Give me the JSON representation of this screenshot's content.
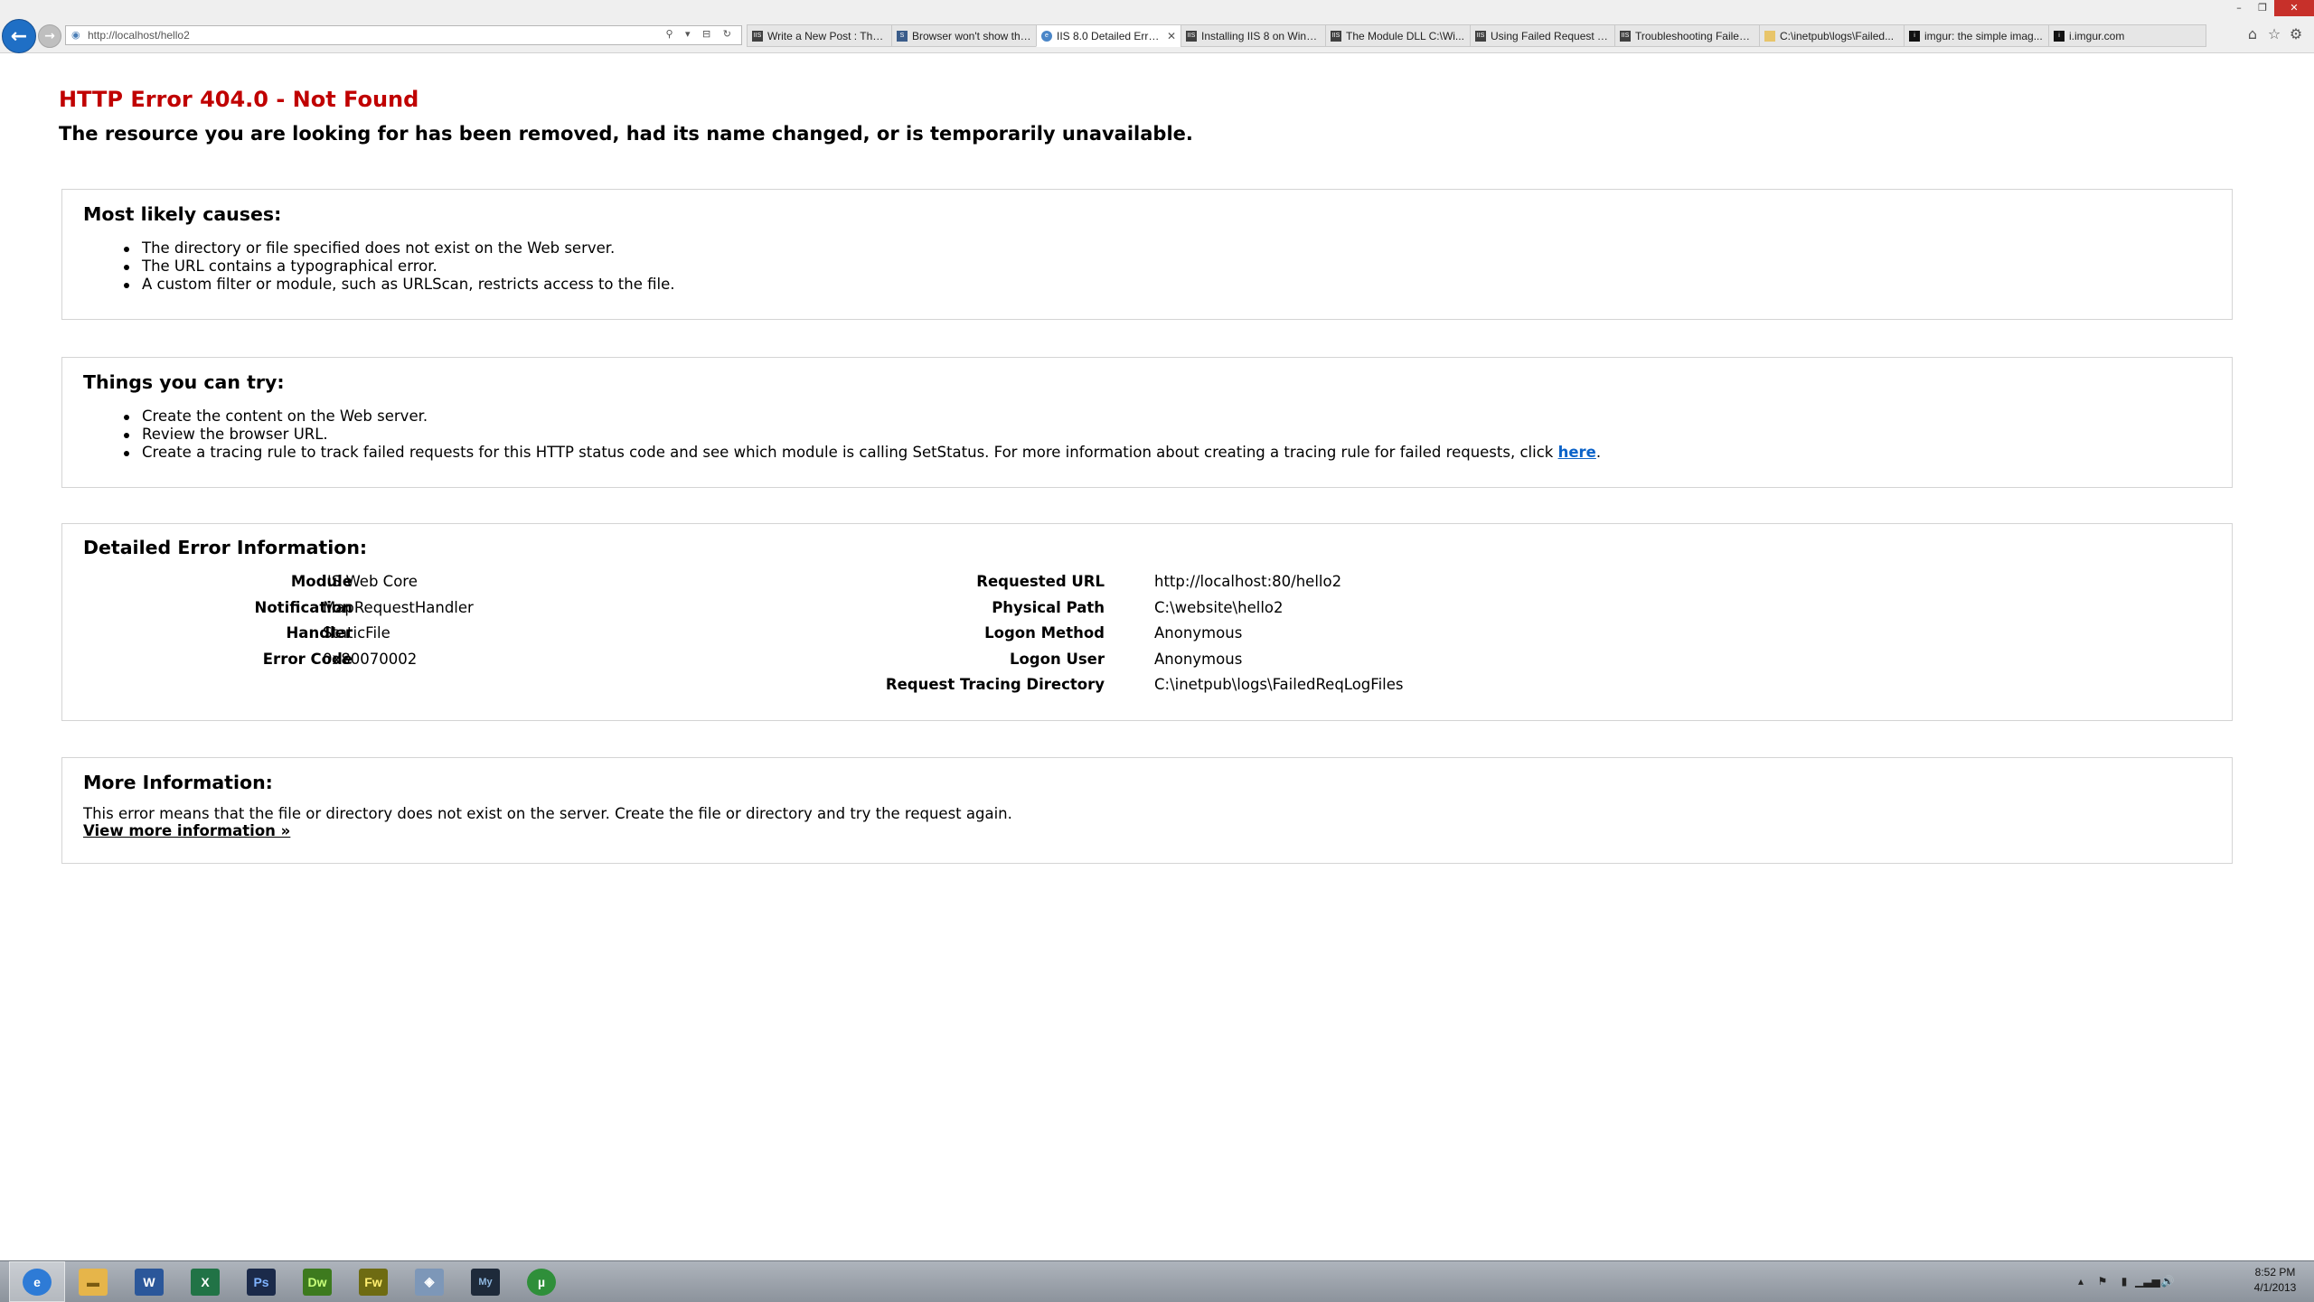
{
  "browser": {
    "window_controls": {
      "minimize": "–",
      "restore": "❐",
      "close": "✕"
    },
    "back_icon": "←",
    "forward_icon": "→",
    "address_url": "http://localhost/hello2",
    "address_tools": "⚲ ▾ ⊟ ↻",
    "tabs": [
      {
        "title": "Write a New Post : The ...",
        "icon": "iis"
      },
      {
        "title": "Browser won't show the...",
        "icon": "ms"
      },
      {
        "title": "IIS 8.0 Detailed Error ...",
        "icon": "ie",
        "active": true,
        "close": "✕"
      },
      {
        "title": "Installing IIS 8 on Wind...",
        "icon": "iis"
      },
      {
        "title": "The Module DLL C:\\Wi...",
        "icon": "iis"
      },
      {
        "title": "Using Failed Request Tr...",
        "icon": "iis"
      },
      {
        "title": "Troubleshooting Failed ...",
        "icon": "iis"
      },
      {
        "title": "C:\\inetpub\\logs\\Failed...",
        "icon": "folder"
      },
      {
        "title": "imgur: the simple imag...",
        "icon": "imgur"
      },
      {
        "title": "i.imgur.com",
        "icon": "imgur"
      }
    ],
    "toolbar_icons": {
      "home": "⌂",
      "favorites": "☆",
      "settings": "⚙"
    }
  },
  "page": {
    "error_title": "HTTP Error 404.0 - Not Found",
    "error_subtitle": "The resource you are looking for has been removed, had its name changed, or is temporarily unavailable.",
    "causes": {
      "heading": "Most likely causes:",
      "items": [
        "The directory or file specified does not exist on the Web server.",
        "The URL contains a typographical error.",
        "A custom filter or module, such as URLScan, restricts access to the file."
      ]
    },
    "try": {
      "heading": "Things you can try:",
      "items": [
        "Create the content on the Web server.",
        "Review the browser URL.",
        "Create a tracing rule to track failed requests for this HTTP status code and see which module is calling SetStatus. For more information about creating a tracing rule for failed requests, click "
      ],
      "link": "here",
      "link_suffix": "."
    },
    "details": {
      "heading": "Detailed Error Information:",
      "left": [
        {
          "label": "Module",
          "value": "IIS Web Core"
        },
        {
          "label": "Notification",
          "value": "MapRequestHandler"
        },
        {
          "label": "Handler",
          "value": "StaticFile"
        },
        {
          "label": "Error Code",
          "value": "0x80070002"
        }
      ],
      "right": [
        {
          "label": "Requested URL",
          "value": "http://localhost:80/hello2"
        },
        {
          "label": "Physical Path",
          "value": "C:\\website\\hello2"
        },
        {
          "label": "Logon Method",
          "value": "Anonymous"
        },
        {
          "label": "Logon User",
          "value": "Anonymous"
        },
        {
          "label": "Request Tracing Directory",
          "value": "C:\\inetpub\\logs\\FailedReqLogFiles"
        }
      ]
    },
    "more_info": {
      "heading": "More Information:",
      "text": "This error means that the file or directory does not exist on the server. Create the file or directory and try the request again.",
      "link": "View more information »"
    }
  },
  "taskbar": {
    "apps": [
      {
        "name": "internet-explorer",
        "glyph": "e",
        "color": "#2e7bd6",
        "active": true
      },
      {
        "name": "file-explorer",
        "glyph": "▬",
        "color": "#e6b54a"
      },
      {
        "name": "word",
        "glyph": "W",
        "color": "#2b579a"
      },
      {
        "name": "excel",
        "glyph": "X",
        "color": "#217346"
      },
      {
        "name": "photoshop",
        "glyph": "Ps",
        "color": "#1b2a4a"
      },
      {
        "name": "dreamweaver",
        "glyph": "Dw",
        "color": "#3d7a1e"
      },
      {
        "name": "fireworks",
        "glyph": "Fw",
        "color": "#6e6b12"
      },
      {
        "name": "network-tool",
        "glyph": "◈",
        "color": "#7d97b8"
      },
      {
        "name": "mysql-workbench",
        "glyph": "My",
        "color": "#1e2a3a"
      },
      {
        "name": "utorrent",
        "glyph": "µ",
        "color": "#2f8f3a"
      }
    ],
    "tray_icons": [
      "▴",
      "⚑",
      "▮",
      "▁▃▅",
      "🔊"
    ],
    "clock": {
      "time": "8:52 PM",
      "date": "4/1/2013"
    }
  }
}
